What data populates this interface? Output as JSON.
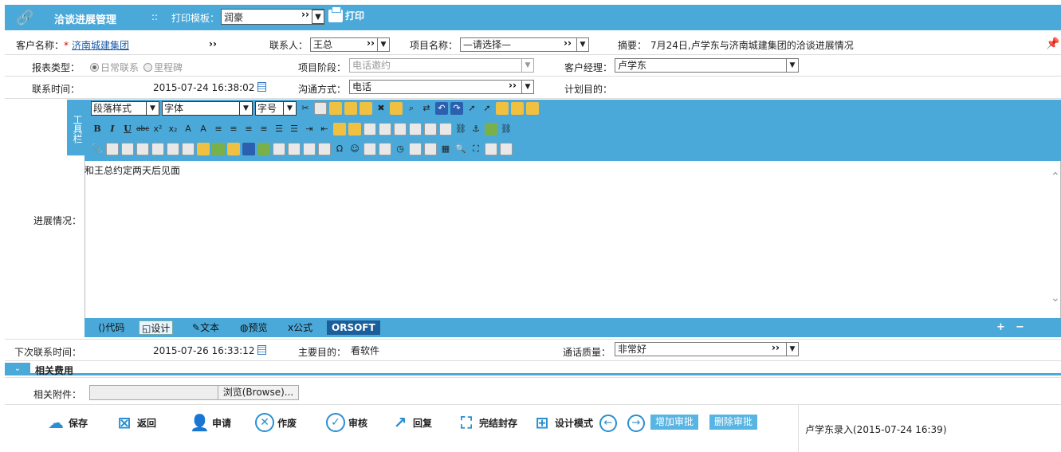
{
  "header": {
    "title": "洽谈进展管理",
    "separator": "::",
    "template_label": "打印模板：",
    "template_value": "润豪",
    "print_label": "打印"
  },
  "form": {
    "customer_label": "客户名称：",
    "required_mark": "*",
    "customer_value": "济南城建集团",
    "contact_label": "联系人：",
    "contact_value": "王总",
    "project_label": "项目名称：",
    "project_value": "—请选择—",
    "summary_label": "摘要：",
    "summary_value": "7月24日,卢学东与济南城建集团的洽谈进展情况",
    "report_type_label": "报表类型：",
    "report_type_opt1": "日常联系",
    "report_type_opt2": "里程碑",
    "stage_label": "项目阶段：",
    "stage_value": "电话邀约",
    "manager_label": "客户经理：",
    "manager_value": "卢学东",
    "contact_time_label": "联系时间：",
    "contact_time_value": "2015-07-24 16:38:02",
    "comm_label": "沟通方式：",
    "comm_value": "电话",
    "plan_label": "计划目的：",
    "plan_value": "",
    "progress_label": "进展情况：",
    "next_time_label": "下次联系时间：",
    "next_time_value": "2015-07-26 16:33:12",
    "purpose_label": "主要目的：",
    "purpose_value": "看软件",
    "quality_label": "通话质量：",
    "quality_value": "非常好",
    "attach_label": "相关附件：",
    "browse_label": "浏览(Browse)..."
  },
  "editor": {
    "side_label": "工具栏",
    "paragraph": "段落样式",
    "font": "字体",
    "size": "字号",
    "content": "和王总约定两天后见面",
    "modes": [
      "代码",
      "设计",
      "文本",
      "预览",
      "公式"
    ],
    "brand": "ORSOFT"
  },
  "section": {
    "title": "相关费用"
  },
  "actions": {
    "save": "保存",
    "back": "返回",
    "apply": "申请",
    "void": "作废",
    "review": "审核",
    "reply": "回复",
    "finish": "完结封存",
    "design": "设计模式",
    "add_approval": "增加审批",
    "del_approval": "删除审批"
  },
  "record_info": "卢学东录入(2015-07-24 16:39)",
  "icons": [
    "link-icon",
    "print-icon",
    "calendar-icon",
    "pin-icon",
    "save-icon",
    "back-icon",
    "apply-icon",
    "void-icon",
    "review-icon",
    "reply-icon",
    "finish-icon",
    "design-icon",
    "prev-icon",
    "next-icon"
  ]
}
